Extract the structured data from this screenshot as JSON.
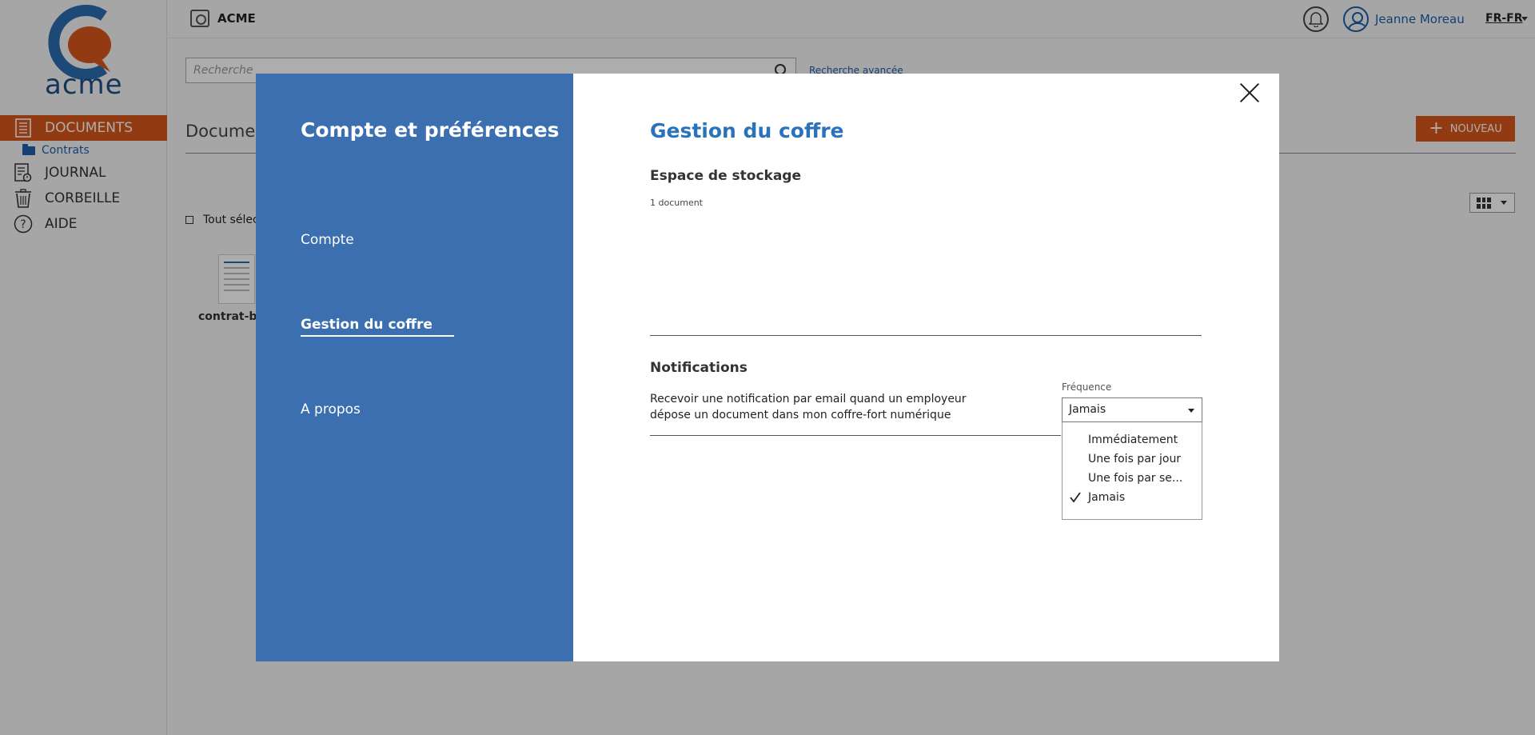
{
  "sidebar": {
    "logo_text": "acme",
    "items": [
      {
        "label": "DOCUMENTS",
        "icon": "document-list-icon"
      },
      {
        "label": "Contrats",
        "icon": "folder-icon"
      },
      {
        "label": "JOURNAL",
        "icon": "journal-icon"
      },
      {
        "label": "CORBEILLE",
        "icon": "trash-icon"
      },
      {
        "label": "AIDE",
        "icon": "help-icon"
      }
    ],
    "accent_color": "#d7561a"
  },
  "topbar": {
    "brand": "ACME",
    "user_name": "Jeanne Moreau",
    "language": "FR-FR"
  },
  "background": {
    "search_placeholder": "Recherche",
    "advanced_search": "Recherche avancée",
    "section_title": "Documen",
    "new_button": "NOUVEAU",
    "select_all": "Tout sélec",
    "file_name": "contrat-ba"
  },
  "modal": {
    "heading": "Compte et préférences",
    "nav": [
      {
        "label": "Compte"
      },
      {
        "label": "Gestion du coffre",
        "active": true
      },
      {
        "label": "A propos"
      }
    ],
    "panel_title": "Gestion du coffre",
    "storage": {
      "title": "Espace de stockage",
      "count": "1 document"
    },
    "notifications": {
      "title": "Notifications",
      "description": "Recevoir une notification par email quand un employeur dépose un document dans mon coffre-fort numérique",
      "frequency_label": "Fréquence",
      "selected": "Jamais",
      "options": [
        "Immédiatement",
        "Une fois par jour",
        "Une fois par se...",
        "Jamais"
      ]
    },
    "left_color": "#3b6fb0",
    "title_color": "#2a73bc"
  }
}
